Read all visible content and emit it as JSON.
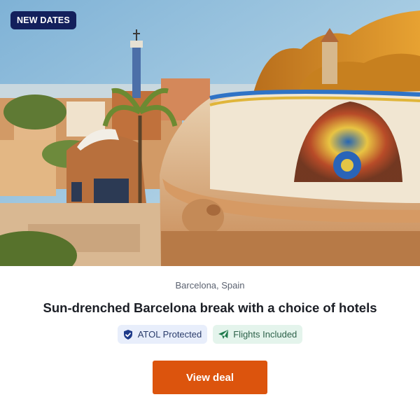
{
  "badge": {
    "label": "NEW DATES"
  },
  "listing": {
    "location": "Barcelona, Spain",
    "title": "Sun-drenched Barcelona break with a choice of hotels"
  },
  "tags": [
    {
      "label": "ATOL Protected",
      "icon": "shield-check-icon"
    },
    {
      "label": "Flights Included",
      "icon": "airplane-icon"
    }
  ],
  "cta": {
    "label": "View deal"
  },
  "colors": {
    "badge_bg": "#13205c",
    "cta_bg": "#dc540d",
    "atol_tag_bg": "#e8eefb",
    "flights_tag_bg": "#e4f4ec"
  }
}
